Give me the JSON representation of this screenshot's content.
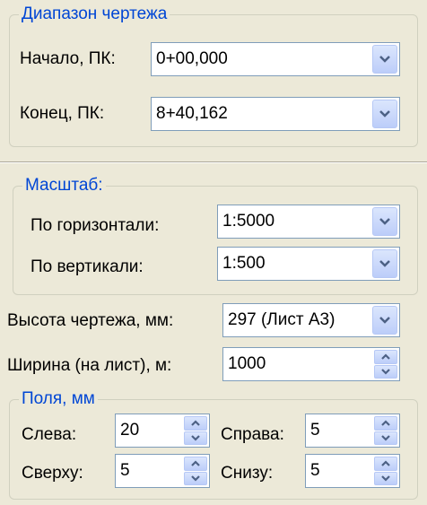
{
  "range": {
    "title": "Диапазон чертежа",
    "start_label": "Начало, ПК:",
    "start_value": "0+00,000",
    "end_label": "Конец, ПК:",
    "end_value": "8+40,162"
  },
  "scale": {
    "title": "Масштаб:",
    "horizontal_label": "По горизонтали:",
    "horizontal_value": "1:5000",
    "vertical_label": "По вертикали:",
    "vertical_value": "1:500"
  },
  "drawing_height": {
    "label": "Высота чертежа, мм:",
    "value": "297 (Лист А3)"
  },
  "width_per_sheet": {
    "label": "Ширина (на лист), м:",
    "value": "1000"
  },
  "margins": {
    "title": "Поля, мм",
    "left_label": "Слева:",
    "left_value": "20",
    "right_label": "Справа:",
    "right_value": "5",
    "top_label": "Сверху:",
    "top_value": "5",
    "bottom_label": "Снизу:",
    "bottom_value": "5"
  },
  "colors": {
    "background": "#ece9d8",
    "group_title": "#0046d5",
    "field_border": "#7f9db9",
    "button_arrow": "#4d6185"
  },
  "icons": {
    "dropdown": "chevron-down-icon",
    "spinner_up": "arrow-up-icon",
    "spinner_down": "arrow-down-icon"
  }
}
